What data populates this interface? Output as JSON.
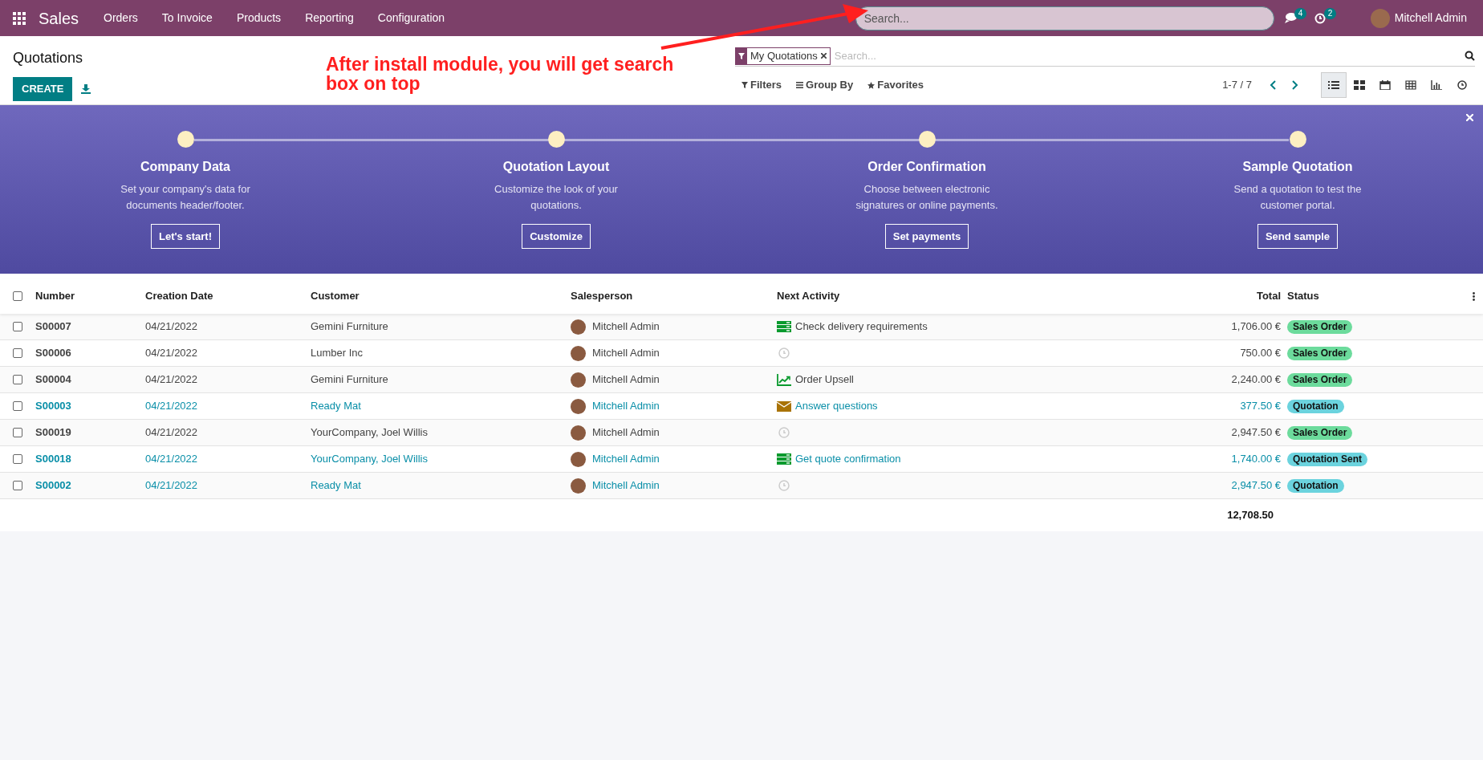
{
  "navbar": {
    "app_name": "Sales",
    "menu": [
      "Orders",
      "To Invoice",
      "Products",
      "Reporting",
      "Configuration"
    ],
    "search_placeholder": "Search...",
    "messages_count": "4",
    "activities_count": "2",
    "user": "Mitchell Admin"
  },
  "annotation": {
    "text": "After install module, you will get search box on top"
  },
  "control_panel": {
    "title": "Quotations",
    "create": "CREATE",
    "facet": "My Quotations",
    "search_placeholder": "Search...",
    "filters": "Filters",
    "group_by": "Group By",
    "favorites": "Favorites",
    "pager": "1-7 / 7",
    "views": [
      {
        "kind": "list",
        "selected": true
      },
      {
        "kind": "kanban",
        "selected": false
      },
      {
        "kind": "calendar",
        "selected": false
      },
      {
        "kind": "pivot",
        "selected": false
      },
      {
        "kind": "graph",
        "selected": false
      },
      {
        "kind": "activity",
        "selected": false
      }
    ]
  },
  "onboarding": {
    "steps": [
      {
        "title": "Company Data",
        "description": "Set your company's data for documents header/footer.",
        "button": "Let's start!"
      },
      {
        "title": "Quotation Layout",
        "description": "Customize the look of your quotations.",
        "button": "Customize"
      },
      {
        "title": "Order Confirmation",
        "description": "Choose between electronic signatures or online payments.",
        "button": "Set payments"
      },
      {
        "title": "Sample Quotation",
        "description": "Send a quotation to test the customer portal.",
        "button": "Send sample"
      }
    ]
  },
  "table": {
    "select_all_checked": false,
    "columns": [
      "Number",
      "Creation Date",
      "Customer",
      "Salesperson",
      "Next Activity",
      "Total",
      "Status"
    ],
    "rows": [
      {
        "number": "S00007",
        "date": "04/21/2022",
        "customer": "Gemini Furniture",
        "salesperson": "Mitchell Admin",
        "activity": {
          "kind": "todo",
          "text": "Check delivery requirements"
        },
        "total": "1,706.00 €",
        "status": {
          "label": "Sales Order",
          "color": "#6cdb9c"
        },
        "highlighted": false,
        "checked": false
      },
      {
        "number": "S00006",
        "date": "04/21/2022",
        "customer": "Lumber Inc",
        "salesperson": "Mitchell Admin",
        "activity": {
          "kind": "none"
        },
        "total": "750.00 €",
        "status": {
          "label": "Sales Order",
          "color": "#6cdb9c"
        },
        "highlighted": false,
        "checked": false
      },
      {
        "number": "S00004",
        "date": "04/21/2022",
        "customer": "Gemini Furniture",
        "salesperson": "Mitchell Admin",
        "activity": {
          "kind": "upsell",
          "text": "Order Upsell"
        },
        "total": "2,240.00 €",
        "status": {
          "label": "Sales Order",
          "color": "#6cdb9c"
        },
        "highlighted": false,
        "checked": false
      },
      {
        "number": "S00003",
        "date": "04/21/2022",
        "customer": "Ready Mat",
        "salesperson": "Mitchell Admin",
        "activity": {
          "kind": "email",
          "text": "Answer questions"
        },
        "total": "377.50 €",
        "status": {
          "label": "Quotation",
          "color": "#6bd3de"
        },
        "highlighted": true,
        "checked": false
      },
      {
        "number": "S00019",
        "date": "04/21/2022",
        "customer": "YourCompany, Joel Willis",
        "salesperson": "Mitchell Admin",
        "activity": {
          "kind": "none"
        },
        "total": "2,947.50 €",
        "status": {
          "label": "Sales Order",
          "color": "#6cdb9c"
        },
        "highlighted": false,
        "checked": false
      },
      {
        "number": "S00018",
        "date": "04/21/2022",
        "customer": "YourCompany, Joel Willis",
        "salesperson": "Mitchell Admin",
        "activity": {
          "kind": "todo",
          "text": "Get quote confirmation"
        },
        "total": "1,740.00 €",
        "status": {
          "label": "Quotation Sent",
          "color": "#6bd3de"
        },
        "highlighted": true,
        "checked": false
      },
      {
        "number": "S00002",
        "date": "04/21/2022",
        "customer": "Ready Mat",
        "salesperson": "Mitchell Admin",
        "activity": {
          "kind": "none"
        },
        "total": "2,947.50 €",
        "status": {
          "label": "Quotation",
          "color": "#6bd3de"
        },
        "highlighted": true,
        "checked": false
      }
    ],
    "grand_total": "12,708.50"
  }
}
